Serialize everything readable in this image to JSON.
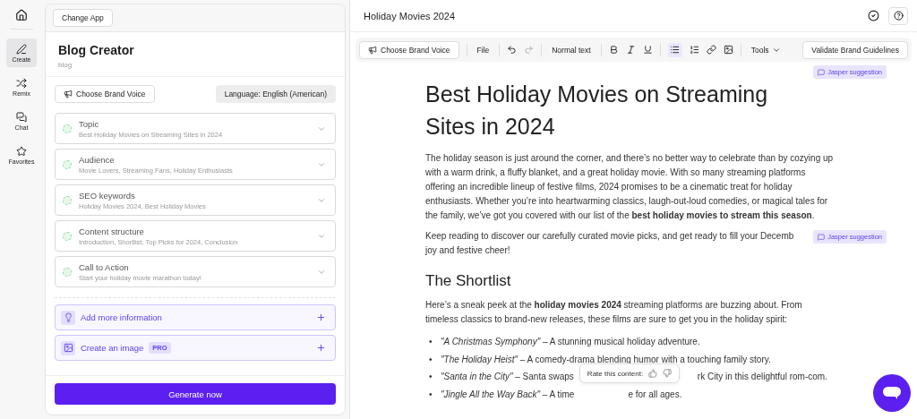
{
  "nav": [
    {
      "label": "Create",
      "selected": true
    },
    {
      "label": "Remix",
      "selected": false
    },
    {
      "label": "Chat",
      "selected": false
    },
    {
      "label": "Favorites",
      "selected": false
    }
  ],
  "left_panel": {
    "change_app": "Change App",
    "title": "Blog Creator",
    "subtitle": "blog",
    "brand_voice": "Choose Brand Voice",
    "language": "Language: English (American)",
    "fields": [
      {
        "label": "Topic",
        "value": "Best Holiday Movies on Streaming Sites in 2024"
      },
      {
        "label": "Audience",
        "value": "Movie Lovers, Streaming Fans, Holiday Enthusiasts"
      },
      {
        "label": "SEO keywords",
        "value": "Holiday Movies 2024, Best Holiday Movies"
      },
      {
        "label": "Content structure",
        "value": "Introduction, Shortlist, Top Picks for 2024, Conclusion"
      },
      {
        "label": "Call to Action",
        "value": "Start your holiday movie marathon today!"
      }
    ],
    "extras": [
      {
        "label": "Add more information"
      },
      {
        "label": "Create an image",
        "badge": "PRO"
      }
    ],
    "generate": "Generate now"
  },
  "editor": {
    "title": "Holiday Movies 2024",
    "toolbar": {
      "brand_voice": "Choose Brand Voice",
      "file": "File",
      "style": "Normal text",
      "tools": "Tools",
      "validate": "Validate Brand Guidelines",
      "bullet_list_active": true
    },
    "heading": "Best Holiday Movies on Streaming Sites in 2024",
    "intro": "The holiday season is just around the corner, and there’s no better way to celebrate than by cozying up with a warm drink, a fluffy blanket, and a great holiday movie. With so many streaming platforms offering an incredible lineup of festive films, 2024 promises to be a cinematic treat for holiday enthusiasts. Whether you’re into heartwarming classics, laugh-out-loud comedies, or magical tales for the family, we’ve got you covered with our list of the **best holiday movies to stream this season**.",
    "keep_reading": [
      "Keep reading to discover our carefully curated movie picks, and get ready to fill your Decemb",
      "joy and festive cheer!"
    ],
    "suggestions": [
      "Jasper suggestion",
      "Jasper suggestion"
    ],
    "subheading": "The Shortlist",
    "shortlist_intro": "Here’s a sneak peek at the **holiday movies 2024** streaming platforms are buzzing about. From timeless classics to brand-new releases, these films are sure to get you in the holiday spirit:",
    "items": [
      {
        "marker": "•",
        "text": "*\"A Christmas Symphony\"* – A stunning musical holiday adventure."
      },
      {
        "marker": "•",
        "text": "*\"The Holiday Heist\"* – A comedy-drama blending humor with a touching family story."
      },
      {
        "marker": "•",
        "text": "*\"Santa in the City\"* – Santa swaps",
        "after": "rk City in this delightful rom-com."
      },
      {
        "marker": "•",
        "text": "*\"Jingle All the Way Back\"* – A time",
        "after": "e for all ages."
      }
    ],
    "rating": "Rate this content:"
  }
}
